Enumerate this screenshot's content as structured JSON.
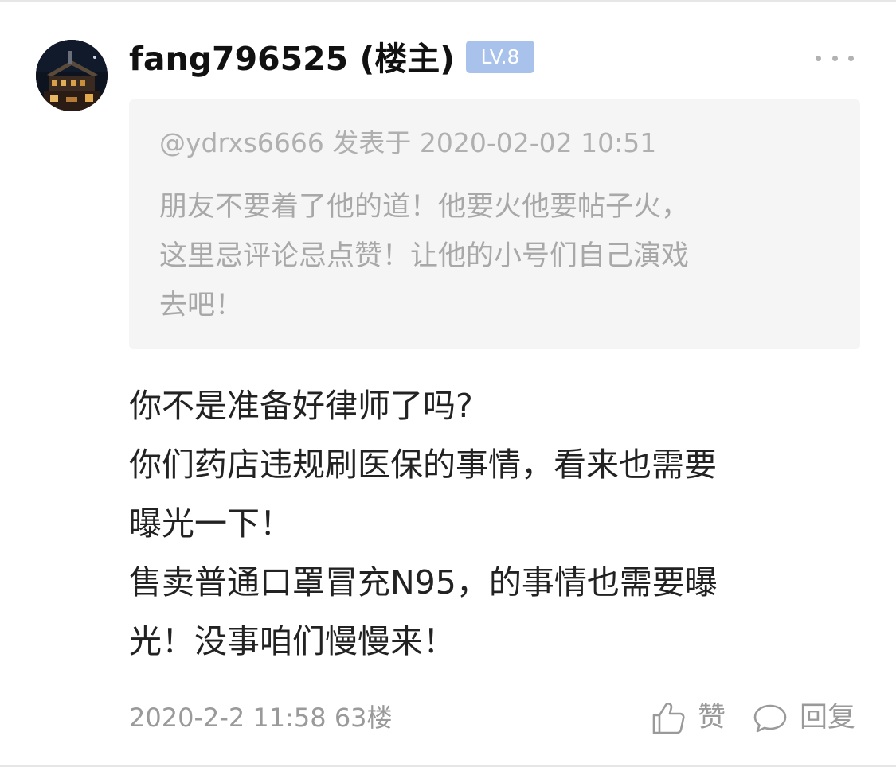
{
  "post": {
    "username": "fang796525 (楼主)",
    "level": "LV.8",
    "avatar_icon": "avatar-night-building",
    "more_icon": "more-dots-icon",
    "quote": {
      "meta": "@ydrxs6666 发表于 2020-02-02 10:51",
      "lines": [
        "朋友不要着了他的道！他要火他要帖子火，",
        "这里忌评论忌点赞！让他的小号们自己演戏",
        "去吧！"
      ]
    },
    "content_lines": [
      "你不是准备好律师了吗?",
      "你们药店违规刷医保的事情，看来也需要",
      "曝光一下！",
      "售卖普通口罩冒充N95，的事情也需要曝",
      "光！没事咱们慢慢来！"
    ],
    "footer": {
      "meta": "2020-2-2 11:58  63楼",
      "like_label": "赞",
      "reply_label": "回复"
    }
  },
  "colors": {
    "badge_bg": "#a8c2ec",
    "quote_bg": "#f5f5f5",
    "muted_text": "#9a9a9a",
    "body_text": "#222222"
  }
}
